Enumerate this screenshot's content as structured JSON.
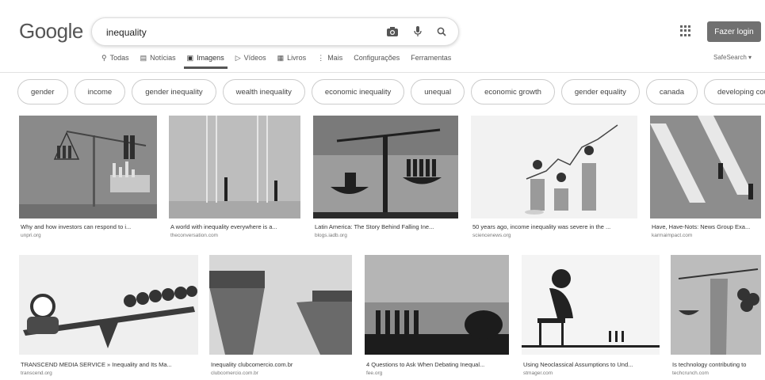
{
  "header": {
    "logo": "Google",
    "search_value": "inequality",
    "login_label": "Fazer login"
  },
  "tabs": [
    {
      "label": "Todas",
      "icon": "search-icon"
    },
    {
      "label": "Notícias",
      "icon": "news-icon"
    },
    {
      "label": "Imagens",
      "icon": "image-icon",
      "active": true
    },
    {
      "label": "Vídeos",
      "icon": "video-icon"
    },
    {
      "label": "Livros",
      "icon": "book-icon"
    },
    {
      "label": "Mais",
      "icon": "more-icon"
    },
    {
      "label": "Configurações"
    },
    {
      "label": "Ferramentas"
    }
  ],
  "safesearch": "SafeSearch ▾",
  "chips": [
    "gender",
    "income",
    "gender inequality",
    "wealth inequality",
    "economic inequality",
    "unequal",
    "economic growth",
    "gender equality",
    "canada",
    "developing cour"
  ],
  "results_row1": [
    {
      "caption": "Why and how investors can respond to i...",
      "source": "unpri.org"
    },
    {
      "caption": "A world with inequality everywhere is a...",
      "source": "theconversation.com"
    },
    {
      "caption": "Latin America: The Story Behind Falling Ine...",
      "source": "blogs.iadb.org"
    },
    {
      "caption": "50 years ago, income inequality was severe in the ...",
      "source": "sciencenews.org"
    },
    {
      "caption": "Have, Have-Nots: News Group Exa...",
      "source": "karmaimpact.com"
    }
  ],
  "results_row2": [
    {
      "caption": "TRANSCEND MEDIA SERVICE » Inequality and Its Ma...",
      "source": "transcend.org"
    },
    {
      "caption": "Inequality clubcomercio.com.br",
      "source": "clubcomercio.com.br"
    },
    {
      "caption": "4 Questions to Ask When Debating Inequal...",
      "source": "fee.org"
    },
    {
      "caption": "Using Neoclassical Assumptions to Und...",
      "source": "stmager.com"
    },
    {
      "caption": "Is technology contributing to",
      "source": "techcrunch.com"
    }
  ],
  "colors": {
    "login_bg": "#707070",
    "accent": "#555555"
  }
}
